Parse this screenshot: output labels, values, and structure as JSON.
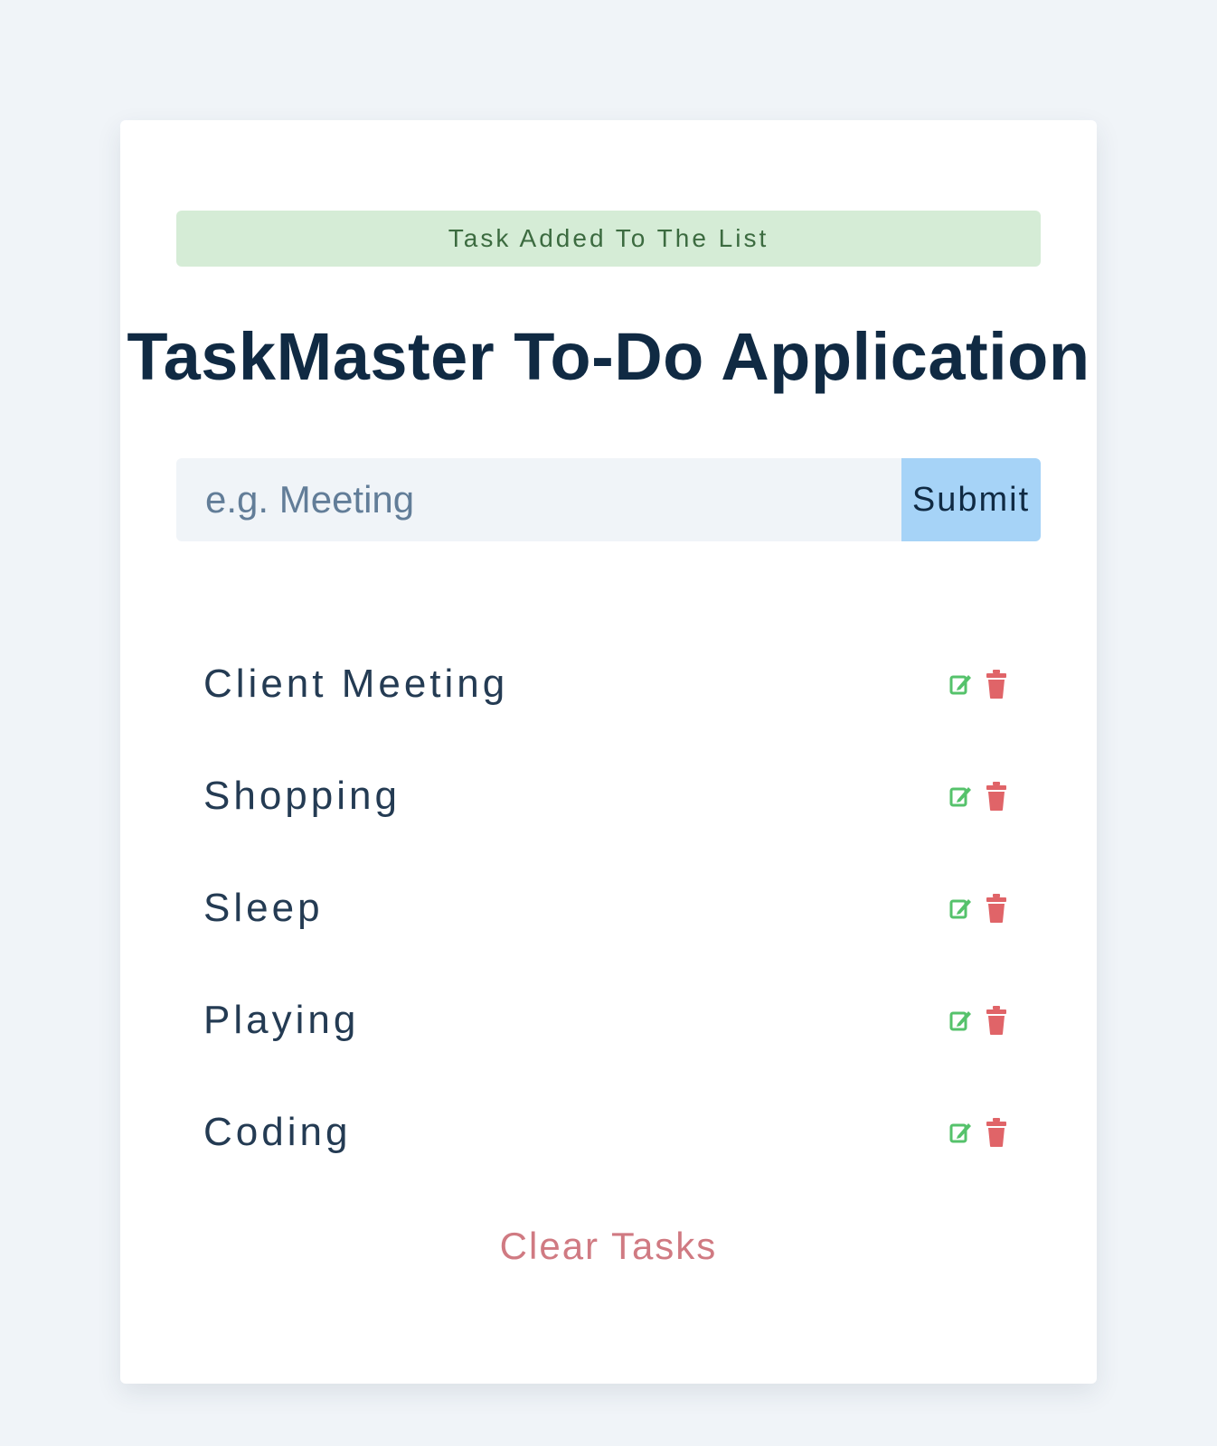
{
  "alert": {
    "text": "Task Added To The List",
    "color": "#d5ecd6"
  },
  "app": {
    "title": "TaskMaster To-Do Application"
  },
  "form": {
    "placeholder": "e.g. Meeting",
    "value": "",
    "submit_label": "Submit"
  },
  "tasks": [
    {
      "name": "Client Meeting"
    },
    {
      "name": "Shopping"
    },
    {
      "name": "Sleep"
    },
    {
      "name": "Playing"
    },
    {
      "name": "Coding"
    }
  ],
  "icons": {
    "edit": "edit-icon",
    "delete": "trash-icon"
  },
  "colors": {
    "edit_icon": "#55c26b",
    "delete_icon": "#e06468",
    "submit_bg": "#a6d3f7",
    "clear_text": "#d07a82",
    "title_text": "#102a43"
  },
  "footer": {
    "clear_label": "Clear Tasks"
  }
}
